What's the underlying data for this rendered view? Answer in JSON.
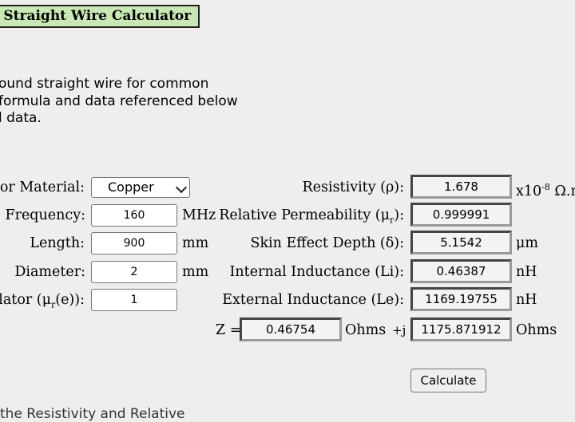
{
  "title": "l Straight Wire Calculator",
  "description": {
    "line1": "ound straight wire for common",
    "line2": "formula and data referenced below",
    "line3": "l data."
  },
  "inputs": {
    "material_label": "tor Material:",
    "material_value": "Copper",
    "frequency_label": "Frequency:",
    "frequency_value": "160",
    "frequency_unit": "MHz",
    "length_label": "Length:",
    "length_value": "900",
    "length_unit": "mm",
    "diameter_label": "Diameter:",
    "diameter_value": "2",
    "diameter_unit": "mm",
    "insulator_label_pre": "lator (μ",
    "insulator_label_sub": "r",
    "insulator_label_post": "(e)):",
    "insulator_value": "1"
  },
  "outputs": {
    "resistivity_label": "Resistivity (ρ):",
    "resistivity_value": "1.678",
    "resistivity_unit_pre": "x10",
    "resistivity_unit_sup": "-8",
    "resistivity_unit_post": " Ω.m",
    "permeability_label_pre": "Relative Permeability (μ",
    "permeability_label_sub": "r",
    "permeability_label_post": "):",
    "permeability_value": "0.999991",
    "skin_label": "Skin Effect Depth (δ):",
    "skin_value": "5.1542",
    "skin_unit": "μm",
    "internal_label": "Internal Inductance (Li):",
    "internal_value": "0.46387",
    "internal_unit": "nH",
    "external_label": "External Inductance (Le):",
    "external_value": "1169.19755",
    "external_unit": "nH",
    "z_label": "Z =",
    "z_real": "0.46754",
    "z_real_unit": "Ohms",
    "z_j": "+j",
    "z_imag": "1175.871912",
    "z_imag_unit": "Ohms"
  },
  "calculate_label": "Calculate",
  "footer_cut": "the Resistivity and Relative"
}
